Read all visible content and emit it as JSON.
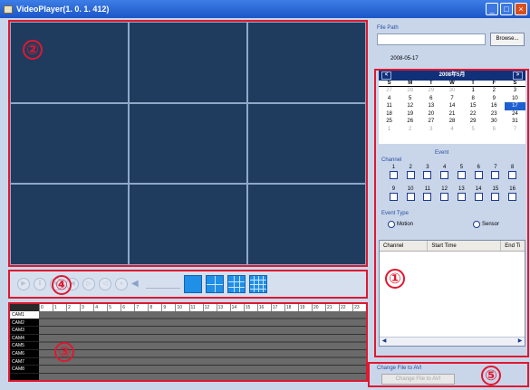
{
  "window": {
    "title": "VideoPlayer(1. 0. 1. 412)"
  },
  "file_path": {
    "label": "File Path",
    "value": "",
    "browse_label": "Browse..."
  },
  "selected_date": "2008-05-17",
  "calendar": {
    "month_label": "2008年5月",
    "prev": "<",
    "next": ">",
    "weekdays": [
      "S",
      "M",
      "T",
      "W",
      "T",
      "F",
      "S"
    ],
    "weeks": [
      [
        "27",
        "28",
        "29",
        "30",
        "1",
        "2",
        "3"
      ],
      [
        "4",
        "5",
        "6",
        "7",
        "8",
        "9",
        "10"
      ],
      [
        "11",
        "12",
        "13",
        "14",
        "15",
        "16",
        "17"
      ],
      [
        "18",
        "19",
        "20",
        "21",
        "22",
        "23",
        "24"
      ],
      [
        "25",
        "26",
        "27",
        "28",
        "29",
        "30",
        "31"
      ],
      [
        "1",
        "2",
        "3",
        "4",
        "5",
        "6",
        "7"
      ]
    ]
  },
  "event": {
    "title": "Event",
    "channel_label": "Channel",
    "channels_row1": [
      "1",
      "2",
      "3",
      "4",
      "5",
      "6",
      "7",
      "8"
    ],
    "channels_row2": [
      "9",
      "10",
      "11",
      "12",
      "13",
      "14",
      "15",
      "16"
    ],
    "type_label": "Event Type",
    "motion": "Motion",
    "sensor": "Sensor"
  },
  "results_table": {
    "columns": [
      "Channel",
      "Start Time",
      "End Ti"
    ]
  },
  "timeline": {
    "hours": [
      "0",
      "1",
      "2",
      "3",
      "4",
      "5",
      "6",
      "7",
      "8",
      "9",
      "10",
      "11",
      "12",
      "13",
      "14",
      "15",
      "16",
      "17",
      "18",
      "19",
      "20",
      "21",
      "22",
      "23"
    ],
    "cameras": [
      "CAM1",
      "CAM2",
      "CAM3",
      "CAM4",
      "CAM5",
      "CAM6",
      "CAM7",
      "CAM8"
    ]
  },
  "avi": {
    "label": "Change File to AVI",
    "button": "Change File to AVI"
  },
  "markers": {
    "m1": "①",
    "m2": "②",
    "m3": "③",
    "m4": "④",
    "m5": "⑤"
  },
  "colors": {
    "annotation": "#e01830",
    "video_bg": "#1f3c5e",
    "accent": "#1f8fe8"
  }
}
